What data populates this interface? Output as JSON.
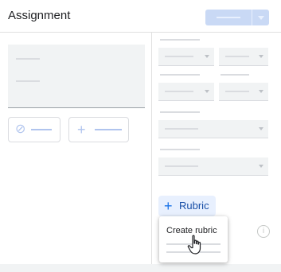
{
  "header": {
    "title": "Assignment",
    "assign_button_label": ""
  },
  "left_panel": {
    "title_field_placeholder": "",
    "instructions_field_placeholder": "",
    "attachments": [
      {
        "icon": "paperclip-icon",
        "glyph": "⊘"
      },
      {
        "icon": "plus-icon",
        "glyph": "+"
      }
    ]
  },
  "right_panel": {
    "rubric_button": {
      "icon": "plus-icon",
      "glyph": "+",
      "label": "Rubric"
    },
    "info_icon": {
      "icon": "info-icon",
      "glyph": "i"
    }
  },
  "rubric_menu": {
    "items": [
      {
        "label": "Create rubric"
      }
    ]
  },
  "colors": {
    "accent": "#1a73e8",
    "accent_light": "#e8f0fe",
    "status_green": "#188038"
  }
}
